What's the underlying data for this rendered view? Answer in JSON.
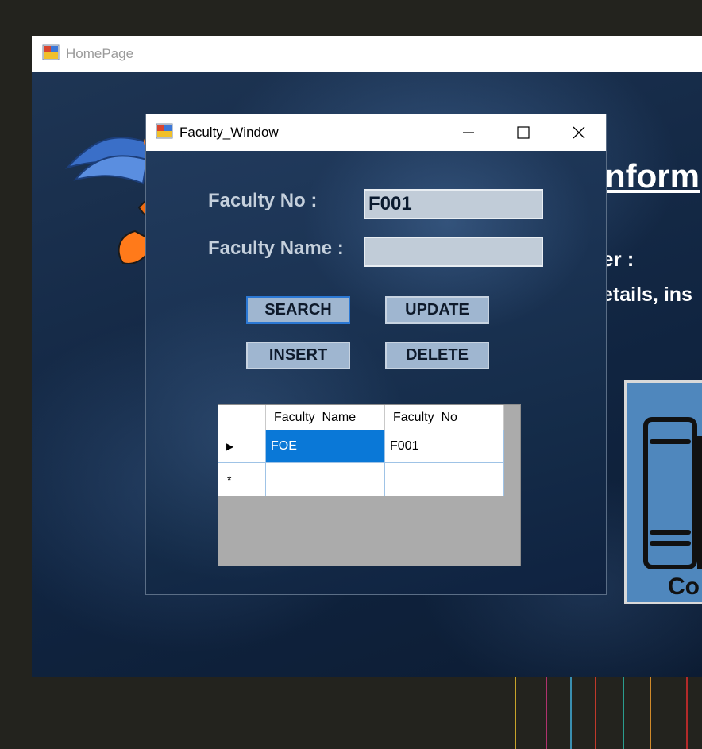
{
  "backdrop": {
    "line_colors": [
      "#c7a32a",
      "#b0326e",
      "#3a8fb0",
      "#c0392b",
      "#2a9d8f",
      "#d08a2a",
      "#b32a2a"
    ]
  },
  "homepage": {
    "title": "HomePage",
    "heading_partial": "nform",
    "subtitle_partial": "er :",
    "description_partial": "etails, ins",
    "course_card_label_partial": "Co"
  },
  "faculty_window": {
    "title": "Faculty_Window",
    "controls": {
      "minimize": "minimize-icon",
      "maximize": "maximize-icon",
      "close": "close-icon"
    },
    "faculty_no_label": "Faculty No :",
    "faculty_no_value": "F001",
    "faculty_name_label": "Faculty Name  :",
    "faculty_name_value": "",
    "buttons": {
      "search": "SEARCH",
      "update": "UPDATE",
      "insert": "INSERT",
      "delete": "DELETE"
    },
    "grid": {
      "columns": [
        "Faculty_Name",
        "Faculty_No"
      ],
      "rows": [
        {
          "Faculty_Name": "FOE",
          "Faculty_No": "F001",
          "selected": true
        }
      ],
      "current_row_marker": "▶",
      "new_row_marker": "*"
    }
  },
  "colors": {
    "accent_selection": "#0a78d7",
    "button_fill": "#9fb6d0",
    "input_fill": "#c1ccd8",
    "course_card": "#4f87bd"
  }
}
